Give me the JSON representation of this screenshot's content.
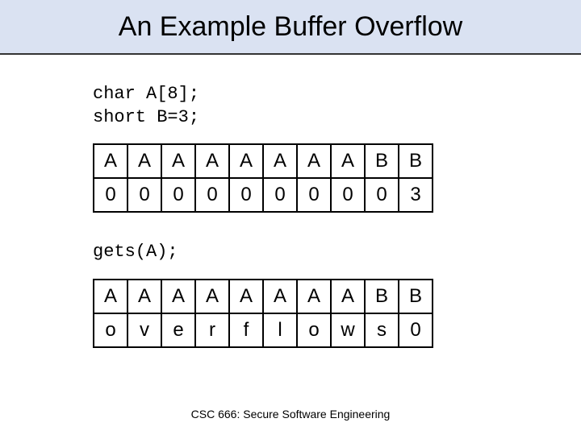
{
  "title": "An Example Buffer Overflow",
  "code1_line1": "char A[8];",
  "code1_line2": "short B=3;",
  "table1": {
    "row1": [
      "A",
      "A",
      "A",
      "A",
      "A",
      "A",
      "A",
      "A",
      "B",
      "B"
    ],
    "row2": [
      "0",
      "0",
      "0",
      "0",
      "0",
      "0",
      "0",
      "0",
      "0",
      "3"
    ]
  },
  "code2": "gets(A);",
  "table2": {
    "row1": [
      "A",
      "A",
      "A",
      "A",
      "A",
      "A",
      "A",
      "A",
      "B",
      "B"
    ],
    "row2": [
      "o",
      "v",
      "e",
      "r",
      "f",
      "l",
      "o",
      "w",
      "s",
      "0"
    ]
  },
  "footer": "CSC 666: Secure Software Engineering"
}
